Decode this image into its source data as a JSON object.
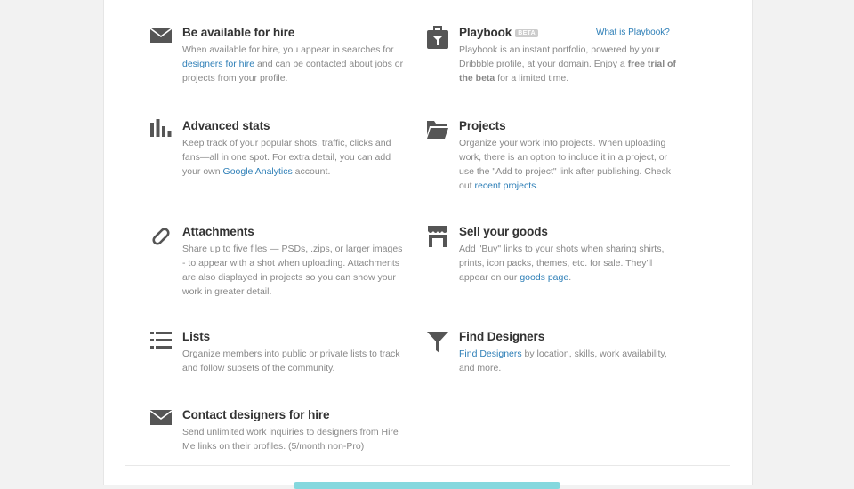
{
  "features": {
    "hire": {
      "icon": "envelope-icon",
      "title": "Be available for hire",
      "desc_1": "When available for hire, you appear in searches for ",
      "link_1": "designers for hire",
      "desc_2": " and can be contacted about jobs or projects from your profile."
    },
    "playbook": {
      "icon": "briefcase-icon",
      "title": "Playbook",
      "badge": "BETA",
      "help_link": "What is Playbook?",
      "desc_1": "Playbook is an instant portfolio, powered by your Dribbble profile, at your domain. Enjoy a ",
      "bold_1": "free trial of the beta",
      "desc_2": " for a limited time."
    },
    "stats": {
      "icon": "bar-chart-icon",
      "title": "Advanced stats",
      "desc_1": "Keep track of your popular shots, traffic, clicks and fans—all in one spot. For extra detail, you can add your own ",
      "link_1": "Google Analytics",
      "desc_2": " account."
    },
    "projects": {
      "icon": "folder-icon",
      "title": "Projects",
      "desc_1": "Organize your work into projects. When uploading work, there is an option to include it in a project, or use the \"Add to project\" link after publishing. Check out ",
      "link_1": "recent projects",
      "desc_2": "."
    },
    "attachments": {
      "icon": "paperclip-icon",
      "title": "Attachments",
      "desc_1": "Share up to five files — PSDs, .zips, or larger images - to appear with a shot when uploading. Attachments are also displayed in projects so you can show your work in greater detail."
    },
    "goods": {
      "icon": "storefront-icon",
      "title": "Sell your goods",
      "desc_1": "Add \"Buy\" links to your shots when sharing shirts, prints, icon packs, themes, etc. for sale. They'll appear on our ",
      "link_1": "goods page",
      "desc_2": "."
    },
    "lists": {
      "icon": "list-icon",
      "title": "Lists",
      "desc_1": "Organize members into public or private lists to track and follow subsets of the community."
    },
    "find": {
      "icon": "funnel-icon",
      "title": "Find Designers",
      "link_1": "Find Designers",
      "desc_2": " by location, skills, work availability, and more."
    },
    "contact": {
      "icon": "envelope-icon",
      "title": "Contact designers for hire",
      "desc_1": "Send unlimited work inquiries to designers from Hire Me links on their profiles. (5/month non-Pro)"
    }
  },
  "colors": {
    "title": "#333333",
    "text": "#888888",
    "link": "#2e7fb7",
    "icon": "#555555",
    "cta": "#85d8de"
  }
}
